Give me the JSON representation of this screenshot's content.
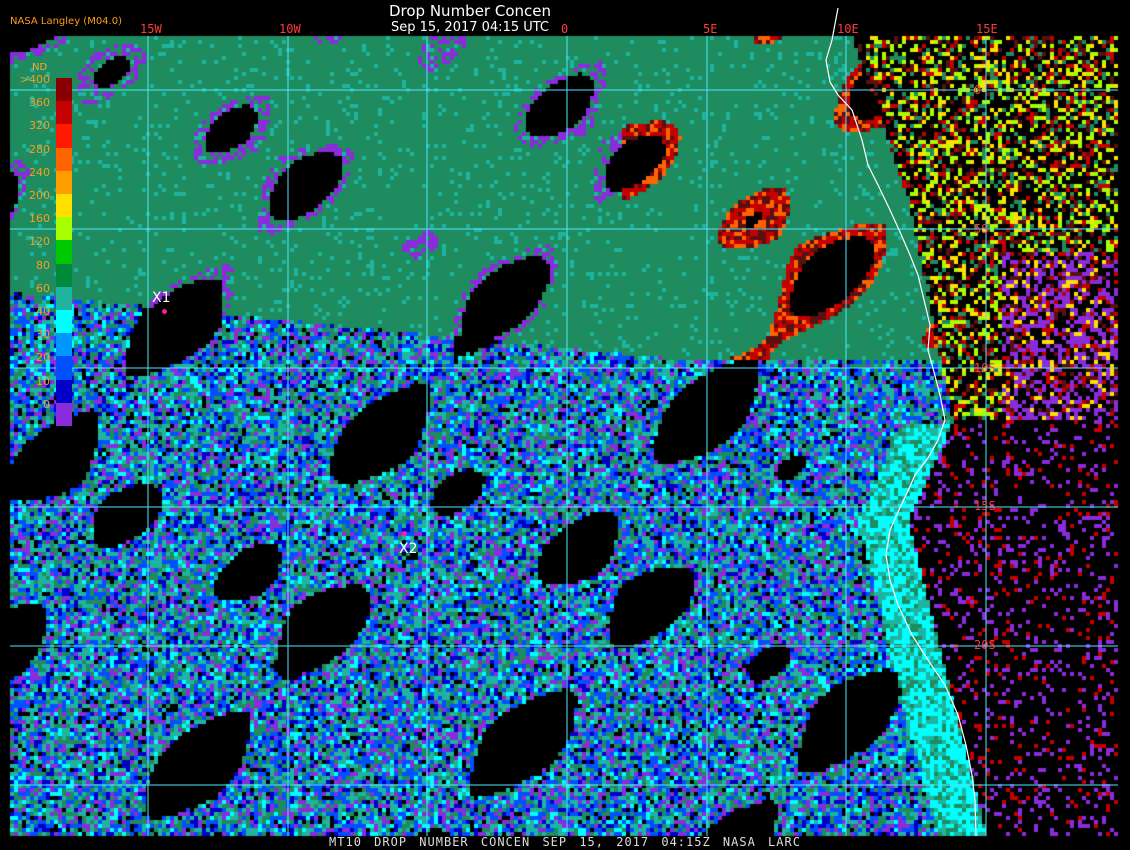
{
  "title": "Drop Number Concen",
  "subtitle": "Sep 15, 2017 04:15 UTC",
  "credit": "NASA Langley (M04.0)",
  "footer": "MT10  DROP NUMBER CONCEN   SEP 15, 2017 04:15Z   NASA LARC",
  "legend": {
    "unit": "ND",
    "labels": [
      ">400",
      "360",
      "320",
      "280",
      "240",
      "200",
      "160",
      "120",
      "80",
      "60",
      "40",
      "30",
      "20",
      "10",
      "0"
    ],
    "colors": [
      "#8a0000",
      "#c40000",
      "#ff1a00",
      "#ff6400",
      "#ff9c00",
      "#ffe000",
      "#a8ff00",
      "#00c800",
      "#008a3c",
      "#1fb4a0",
      "#00ffff",
      "#0096ff",
      "#0050ff",
      "#0000c8",
      "#8a2bdc"
    ]
  },
  "longitude_labels": [
    "15W",
    "10W",
    "0",
    "5E",
    "10E",
    "15E"
  ],
  "latitude_labels": [
    "0",
    "5S",
    "10S",
    "15S",
    "20S"
  ],
  "markers": [
    {
      "label": "X1"
    },
    {
      "label": "X2"
    }
  ]
}
